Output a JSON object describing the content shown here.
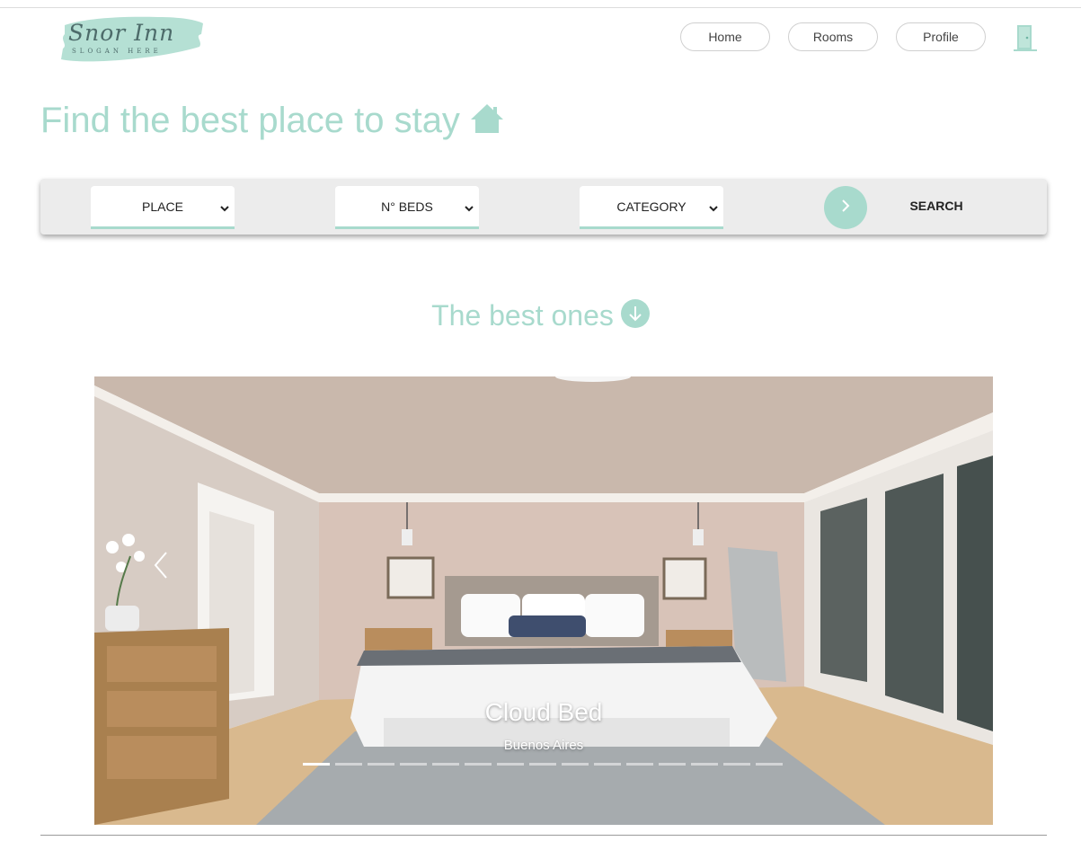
{
  "logo": {
    "title": "Snor Inn",
    "slogan": "SLOGAN HERE",
    "brush_color": "#a8dacd"
  },
  "nav": {
    "items": [
      {
        "label": "Home"
      },
      {
        "label": "Rooms"
      },
      {
        "label": "Profile"
      }
    ],
    "logout_icon": "door-icon"
  },
  "hero": {
    "title": "Find the best place to stay",
    "icon": "house-icon"
  },
  "search": {
    "place": {
      "selected": "PLACE"
    },
    "beds": {
      "selected": "N° BEDS"
    },
    "category": {
      "selected": "CATEGORY"
    },
    "go_icon": "chevron-right-icon",
    "button_label": "SEARCH"
  },
  "section": {
    "title": "The best ones",
    "icon": "arrow-down-circle-icon"
  },
  "carousel": {
    "slide": {
      "title": "Cloud Bed",
      "subtitle": "Buenos Aires",
      "image": "bedroom-photo"
    },
    "slide_count": 15,
    "active_index": 0,
    "prev_icon": "chevron-left-icon",
    "next_icon": "chevron-right-icon"
  },
  "colors": {
    "accent": "#a8dacd",
    "searchbar_bg": "#ececec",
    "text": "#222222"
  }
}
